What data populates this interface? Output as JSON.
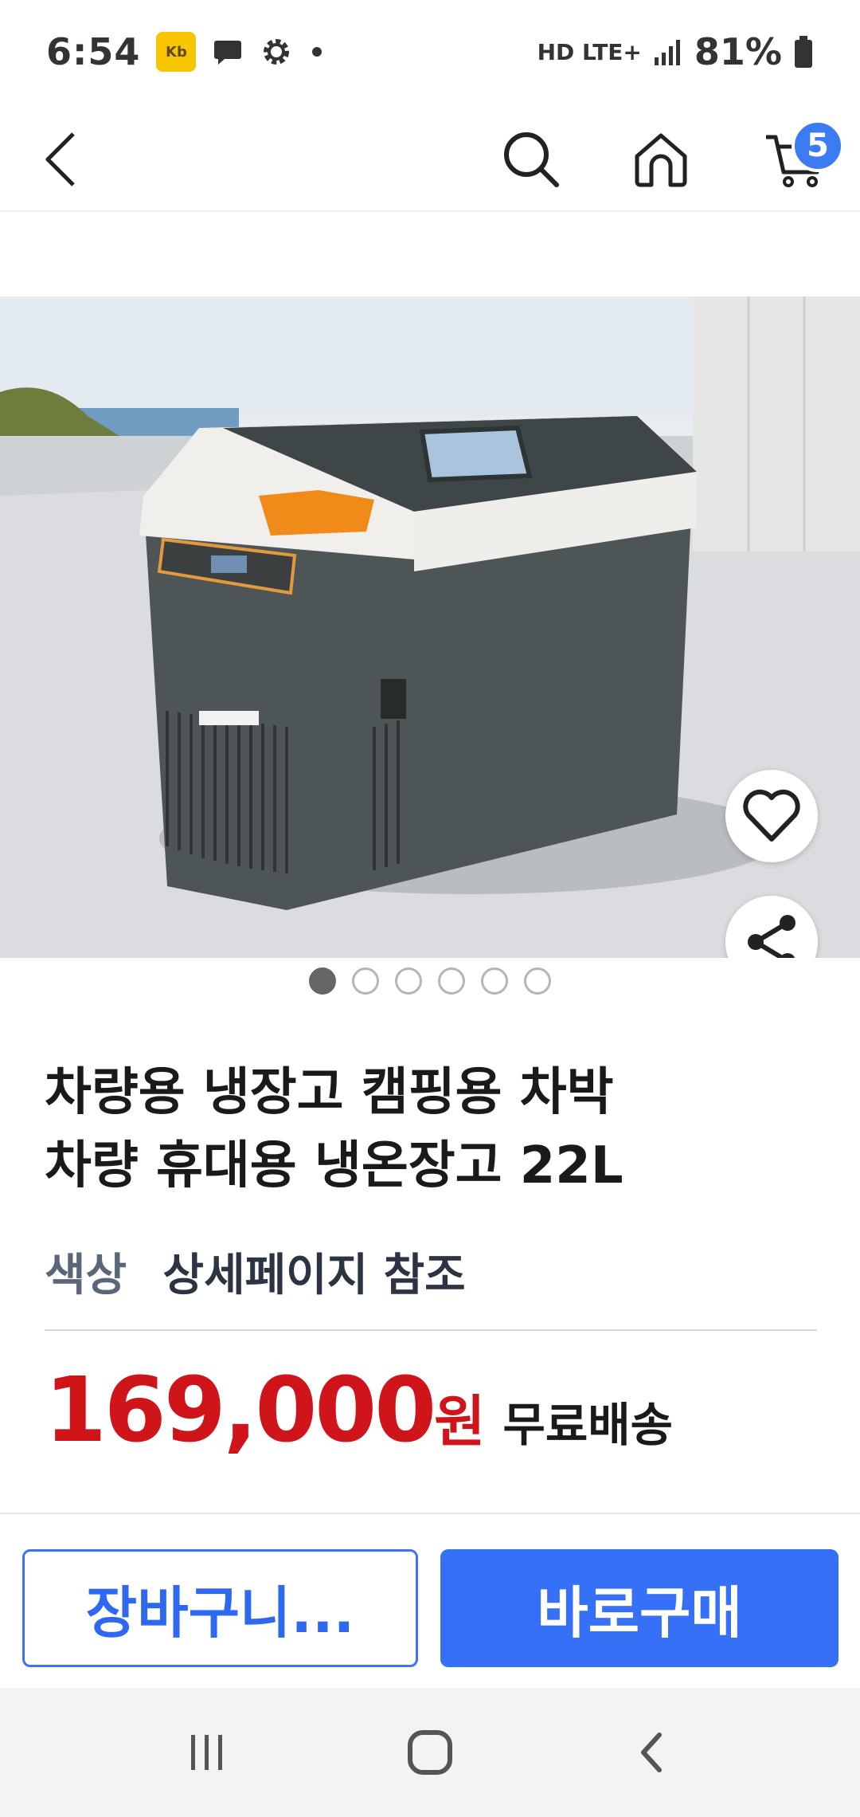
{
  "status_bar": {
    "time": "6:54",
    "kb_badge": "Kb",
    "network": "HD LTE+",
    "battery": "81%"
  },
  "app_bar": {
    "cart_count": "5"
  },
  "gallery": {
    "total_images": 6,
    "active_index": 0
  },
  "product": {
    "title_line1": "차량용 냉장고 캠핑용 차박",
    "title_line2": "차량 휴대용 냉온장고 22L",
    "option_label": "색상",
    "option_value": "상세페이지 참조",
    "price": "169,000",
    "price_unit": "원",
    "shipping": "무료배송"
  },
  "actions": {
    "cart_label": "장바구니...",
    "buy_label": "바로구매"
  },
  "colors": {
    "accent_blue": "#3670f7",
    "price_red": "#d0151a",
    "badge_blue": "#3d7bf3"
  }
}
